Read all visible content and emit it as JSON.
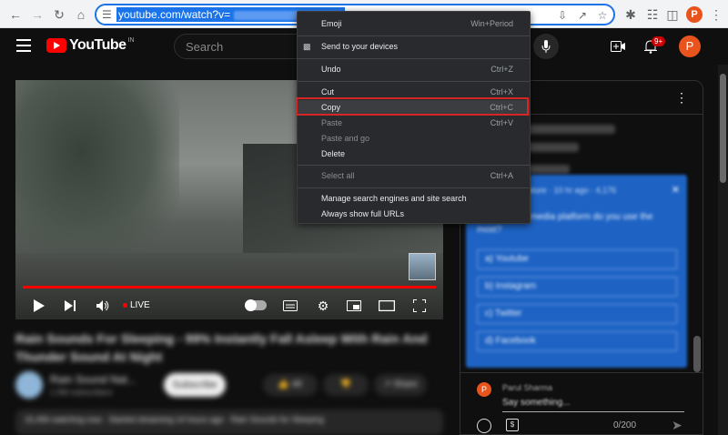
{
  "browser": {
    "url_visible": "youtube.com/watch?v=",
    "avatar_letter": "P"
  },
  "youtube": {
    "logo_text": "YouTube",
    "country_code": "IN",
    "search_placeholder": "Search",
    "notification_count": "9+",
    "avatar_letter": "P"
  },
  "player": {
    "live_label": "LIVE"
  },
  "video_info": {
    "title": "Rain Sounds For Sleeping - 99% Instantly Fall Asleep With Rain And Thunder Sound At Night",
    "channel_name": "Rain Sound Nat...",
    "subscribe_label": "Subscribe",
    "description": "15,456 watching now · Started streaming 14 hours ago · Rain Sounds for Sleeping"
  },
  "chat": {
    "poll": {
      "header": "Rain Sound Nature · 10 hr ago · 4,176",
      "question": "Which social media platform do you use the most?",
      "options": [
        "a) Youtube",
        "b) Instagram",
        "c) Twitter",
        "d) Facebook"
      ]
    },
    "user_name": "Parul Sharma",
    "input_placeholder": "Say something...",
    "char_count": "0/200"
  },
  "context_menu": {
    "items": [
      {
        "label": "Emoji",
        "shortcut": "Win+Period",
        "enabled": true
      },
      {
        "label": "Send to your devices",
        "shortcut": "",
        "enabled": true
      },
      {
        "label": "Undo",
        "shortcut": "Ctrl+Z",
        "enabled": true
      },
      {
        "label": "Cut",
        "shortcut": "Ctrl+X",
        "enabled": true
      },
      {
        "label": "Copy",
        "shortcut": "Ctrl+C",
        "enabled": true,
        "highlighted": true
      },
      {
        "label": "Paste",
        "shortcut": "Ctrl+V",
        "enabled": false
      },
      {
        "label": "Paste and go",
        "shortcut": "",
        "enabled": false
      },
      {
        "label": "Delete",
        "shortcut": "",
        "enabled": true
      },
      {
        "label": "Select all",
        "shortcut": "Ctrl+A",
        "enabled": false
      },
      {
        "label": "Manage search engines and site search",
        "shortcut": "",
        "enabled": true
      },
      {
        "label": "Always show full URLs",
        "shortcut": "",
        "enabled": true
      }
    ]
  },
  "colors": {
    "highlight_box": "#d62525",
    "selection": "#1a73e8",
    "youtube_red": "#ff0000"
  }
}
